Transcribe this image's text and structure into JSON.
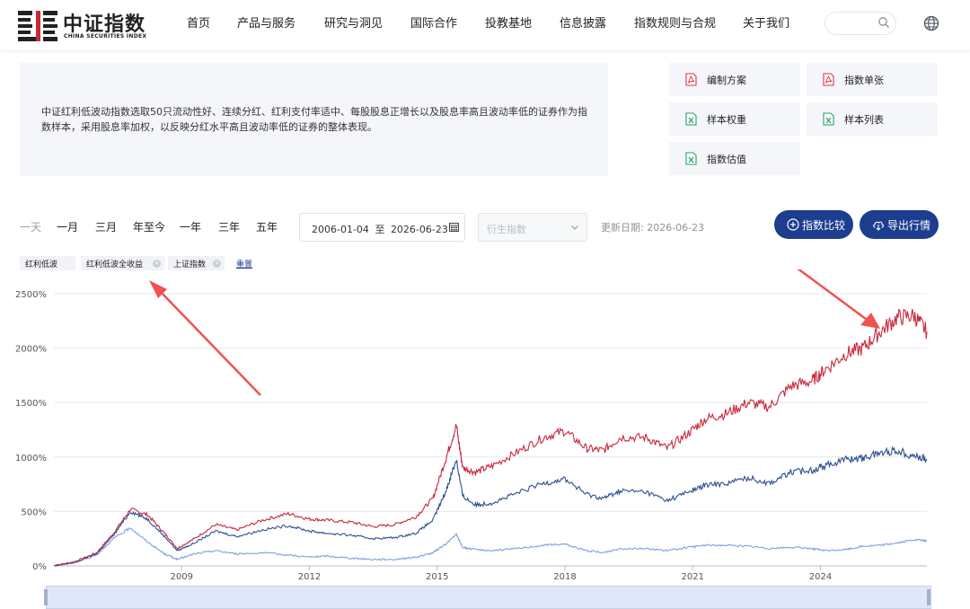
{
  "header": {
    "logo_cn": "中证指数",
    "logo_en": "CHINA SECURITIES INDEX",
    "nav": [
      "首页",
      "产品与服务",
      "研究与洞见",
      "国际合作",
      "投教基地",
      "信息披露",
      "指数规则与合规",
      "关于我们"
    ],
    "search_placeholder": ""
  },
  "description": "中证红利低波动指数选取50只流动性好、连续分红、红利支付率适中、每股股息正增长以及股息率高且波动率低的证券作为指数样本，采用股息率加权，以反映分红水平高且波动率低的证券的整体表现。",
  "docs": [
    {
      "label": "编制方案",
      "type": "pdf"
    },
    {
      "label": "指数单张",
      "type": "pdf"
    },
    {
      "label": "样本权重",
      "type": "excel"
    },
    {
      "label": "样本列表",
      "type": "excel"
    },
    {
      "label": "指数估值",
      "type": "excel"
    }
  ],
  "controls": {
    "periods": [
      "一天",
      "一月",
      "三月",
      "年至今",
      "一年",
      "三年",
      "五年"
    ],
    "date_start": "2006-01-04",
    "date_sep": "至",
    "date_end": "2026-06-23",
    "derive_placeholder": "衍生指数",
    "update_label": "更新日期: 2026-06-23",
    "compare_label": "指数比较",
    "export_label": "导出行情"
  },
  "legend": {
    "chips": [
      "红利低波",
      "红利低波全收益",
      "上证指数"
    ],
    "reset": "重置"
  },
  "colors": {
    "primary": "#1d3d8f",
    "red_series": "#c8283a",
    "blue_series": "#2c4f8f",
    "light_series": "#7f9fe0",
    "arrow": "#f0524f"
  },
  "chart_data": {
    "type": "line",
    "x_ticks": [
      "2009",
      "2012",
      "2015",
      "2018",
      "2021",
      "2024"
    ],
    "y_ticks": [
      "0%",
      "500%",
      "1000%",
      "1500%",
      "2000%",
      "2500%"
    ],
    "ylim": [
      0,
      2500
    ],
    "xlim": [
      2006.0,
      2026.5
    ],
    "grid": true,
    "series": [
      {
        "name": "红利低波全收益",
        "color": "#c8283a",
        "x": [
          2006.0,
          2006.5,
          2007.0,
          2007.4,
          2007.8,
          2008.2,
          2008.6,
          2008.9,
          2009.3,
          2009.8,
          2010.3,
          2010.9,
          2011.5,
          2012.0,
          2012.4,
          2013.0,
          2013.5,
          2014.0,
          2014.5,
          2014.9,
          2015.2,
          2015.45,
          2015.6,
          2015.9,
          2016.3,
          2016.9,
          2017.5,
          2018.0,
          2018.5,
          2018.9,
          2019.3,
          2019.9,
          2020.4,
          2020.9,
          2021.3,
          2021.8,
          2022.3,
          2022.8,
          2023.3,
          2023.8,
          2024.1,
          2024.6,
          2025.0,
          2025.4,
          2025.8,
          2026.2,
          2026.5
        ],
        "y": [
          0,
          40,
          120,
          300,
          520,
          470,
          300,
          160,
          250,
          380,
          330,
          420,
          480,
          430,
          420,
          400,
          360,
          380,
          450,
          620,
          980,
          1290,
          900,
          860,
          920,
          1050,
          1180,
          1240,
          1080,
          1060,
          1180,
          1180,
          1080,
          1220,
          1350,
          1400,
          1500,
          1460,
          1650,
          1700,
          1800,
          1950,
          2000,
          2150,
          2280,
          2300,
          2150
        ]
      },
      {
        "name": "红利低波",
        "color": "#2c4f8f",
        "x": [
          2006.0,
          2006.5,
          2007.0,
          2007.4,
          2007.8,
          2008.2,
          2008.6,
          2008.9,
          2009.3,
          2009.8,
          2010.3,
          2010.9,
          2011.5,
          2012.0,
          2012.4,
          2013.0,
          2013.5,
          2014.0,
          2014.5,
          2014.9,
          2015.2,
          2015.45,
          2015.6,
          2015.9,
          2016.3,
          2016.9,
          2017.5,
          2018.0,
          2018.5,
          2018.9,
          2019.3,
          2019.9,
          2020.4,
          2020.9,
          2021.3,
          2021.8,
          2022.3,
          2022.8,
          2023.3,
          2023.8,
          2024.1,
          2024.6,
          2025.0,
          2025.4,
          2025.8,
          2026.2,
          2026.5
        ],
        "y": [
          0,
          35,
          110,
          280,
          500,
          430,
          270,
          140,
          210,
          320,
          270,
          330,
          370,
          320,
          300,
          280,
          250,
          260,
          300,
          420,
          680,
          980,
          640,
          560,
          580,
          670,
          760,
          800,
          660,
          620,
          690,
          680,
          600,
          680,
          740,
          760,
          810,
          760,
          860,
          880,
          920,
          980,
          990,
          1040,
          1060,
          1010,
          980
        ]
      },
      {
        "name": "上证指数",
        "color": "#7f9fe0",
        "x": [
          2006.0,
          2006.5,
          2007.0,
          2007.4,
          2007.8,
          2008.2,
          2008.6,
          2008.9,
          2009.3,
          2009.8,
          2010.3,
          2010.9,
          2011.5,
          2012.0,
          2012.4,
          2013.0,
          2013.5,
          2014.0,
          2014.5,
          2014.9,
          2015.2,
          2015.45,
          2015.6,
          2015.9,
          2016.3,
          2016.9,
          2017.5,
          2018.0,
          2018.5,
          2018.9,
          2019.3,
          2019.9,
          2020.4,
          2020.9,
          2021.3,
          2021.8,
          2022.3,
          2022.8,
          2023.3,
          2023.8,
          2024.1,
          2024.6,
          2025.0,
          2025.4,
          2025.8,
          2026.2,
          2026.5
        ],
        "y": [
          0,
          30,
          100,
          250,
          350,
          220,
          110,
          60,
          110,
          140,
          110,
          120,
          100,
          80,
          90,
          70,
          60,
          60,
          80,
          120,
          200,
          290,
          170,
          150,
          140,
          160,
          190,
          200,
          140,
          120,
          160,
          160,
          140,
          170,
          190,
          190,
          180,
          160,
          170,
          160,
          140,
          150,
          180,
          190,
          210,
          240,
          230
        ]
      }
    ]
  }
}
